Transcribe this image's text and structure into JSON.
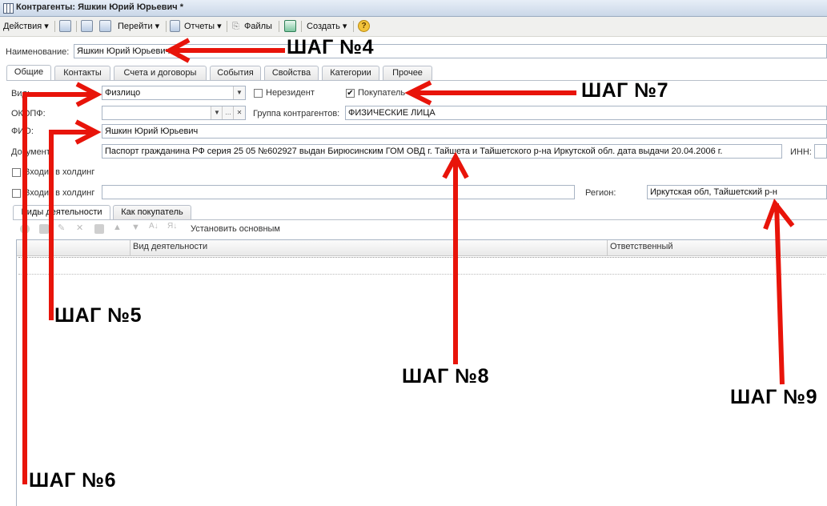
{
  "window": {
    "title": "Контрагенты: Яшкин Юрий Юрьевич *"
  },
  "toolbar": {
    "actions_label": "Действия",
    "goto_label": "Перейти",
    "reports_label": "Отчеты",
    "files_label": "Файлы",
    "create_label": "Создать",
    "help_label": "?"
  },
  "form": {
    "name_label": "Наименование:",
    "name_value": "Яшкин Юрий Юрьевич",
    "kind_label": "Вид:",
    "kind_value": "Физлицо",
    "nonresident_label": "Нерезидент",
    "nonresident_checked": false,
    "buyer_label": "Покупатель",
    "buyer_checked": true,
    "okopf_label": "ОКОПФ:",
    "okopf_value": "",
    "group_label": "Группа контрагентов:",
    "group_value": "ФИЗИЧЕСКИЕ ЛИЦА",
    "fio_label": "ФИО:",
    "fio_value": "Яшкин Юрий Юрьевич",
    "document_label": "Документ:",
    "document_value": "Паспорт гражданина РФ серия 25 05 №602927 выдан Бирюсинским ГОМ ОВД г. Тайшета и Тайшетского р-на Иркутской обл. дата выдачи 20.04.2006 г.",
    "inn_label": "ИНН:",
    "inn_value": "",
    "holding1_label": "Входит в холдинг",
    "holding2_label": "Входит в холдинг",
    "holding2_value": "",
    "region_label": "Регион:",
    "region_value": "Иркутская обл, Тайшетский р-н"
  },
  "tabs": [
    "Общие",
    "Контакты",
    "Счета и договоры",
    "События",
    "Свойства",
    "Категории",
    "Прочее"
  ],
  "inner_tabs": [
    "Виды деятельности",
    "Как покупатель"
  ],
  "inner_toolbar": {
    "set_main_label": "Установить основным"
  },
  "grid": {
    "columns": [
      "Вид деятельности",
      "Ответственный"
    ]
  },
  "annotations": {
    "step4": "ШАГ №4",
    "step5": "ШАГ №5",
    "step6": "ШАГ №6",
    "step7": "ШАГ №7",
    "step8": "ШАГ №8",
    "step9": "ШАГ №9",
    "arrow_color": "#e8140a"
  }
}
